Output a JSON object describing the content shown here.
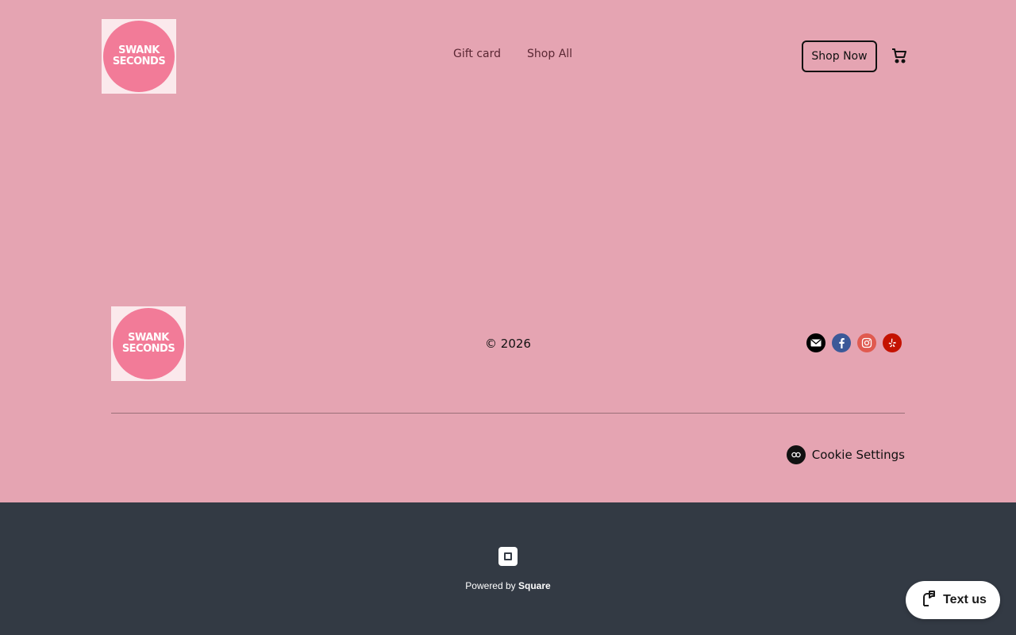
{
  "header": {
    "logo_text_line1": "SWANK",
    "logo_text_line2": "SECONDS",
    "nav": [
      "Gift card",
      "Shop All"
    ],
    "cta_label": "Shop Now"
  },
  "footer": {
    "logo_text_line1": "SWANK",
    "logo_text_line2": "SECONDS",
    "copyright": "© 2026",
    "socials": [
      {
        "name": "email-icon",
        "color": "#000000"
      },
      {
        "name": "facebook-icon",
        "color": "#3b5998"
      },
      {
        "name": "instagram-icon",
        "color": "#e05a4f"
      },
      {
        "name": "yelp-icon",
        "color": "#c41200"
      }
    ],
    "cookie_label": "Cookie Settings"
  },
  "powered": {
    "prefix": "Powered by ",
    "brand": "Square"
  },
  "chat": {
    "label": "Text us"
  },
  "colors": {
    "background": "#e5a4b2",
    "footer_bar": "#333a44",
    "logo_circle": "#f27b98"
  }
}
